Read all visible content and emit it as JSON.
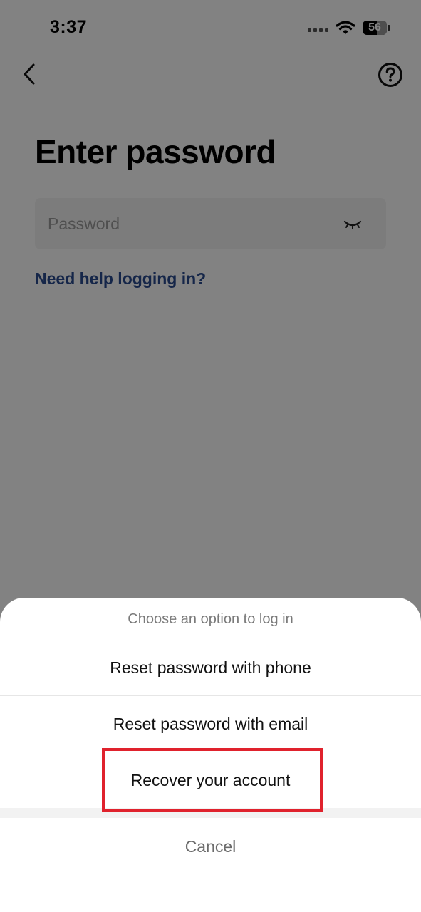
{
  "status_bar": {
    "time": "3:37",
    "battery": "56"
  },
  "header": {
    "back_icon": "chevron-left-icon",
    "help_icon": "question-circle-icon"
  },
  "page": {
    "title": "Enter password",
    "password_placeholder": "Password",
    "password_value": "",
    "eye_icon": "eye-closed-icon",
    "help_link": "Need help logging in?"
  },
  "sheet": {
    "title": "Choose an option to log in",
    "options": [
      {
        "label": "Reset password with phone"
      },
      {
        "label": "Reset password with email"
      },
      {
        "label": "Recover your account"
      }
    ],
    "cancel": "Cancel"
  },
  "colors": {
    "link": "#2a4b8f",
    "highlight": "#e0222d",
    "field_background": "#f3f3f3"
  }
}
